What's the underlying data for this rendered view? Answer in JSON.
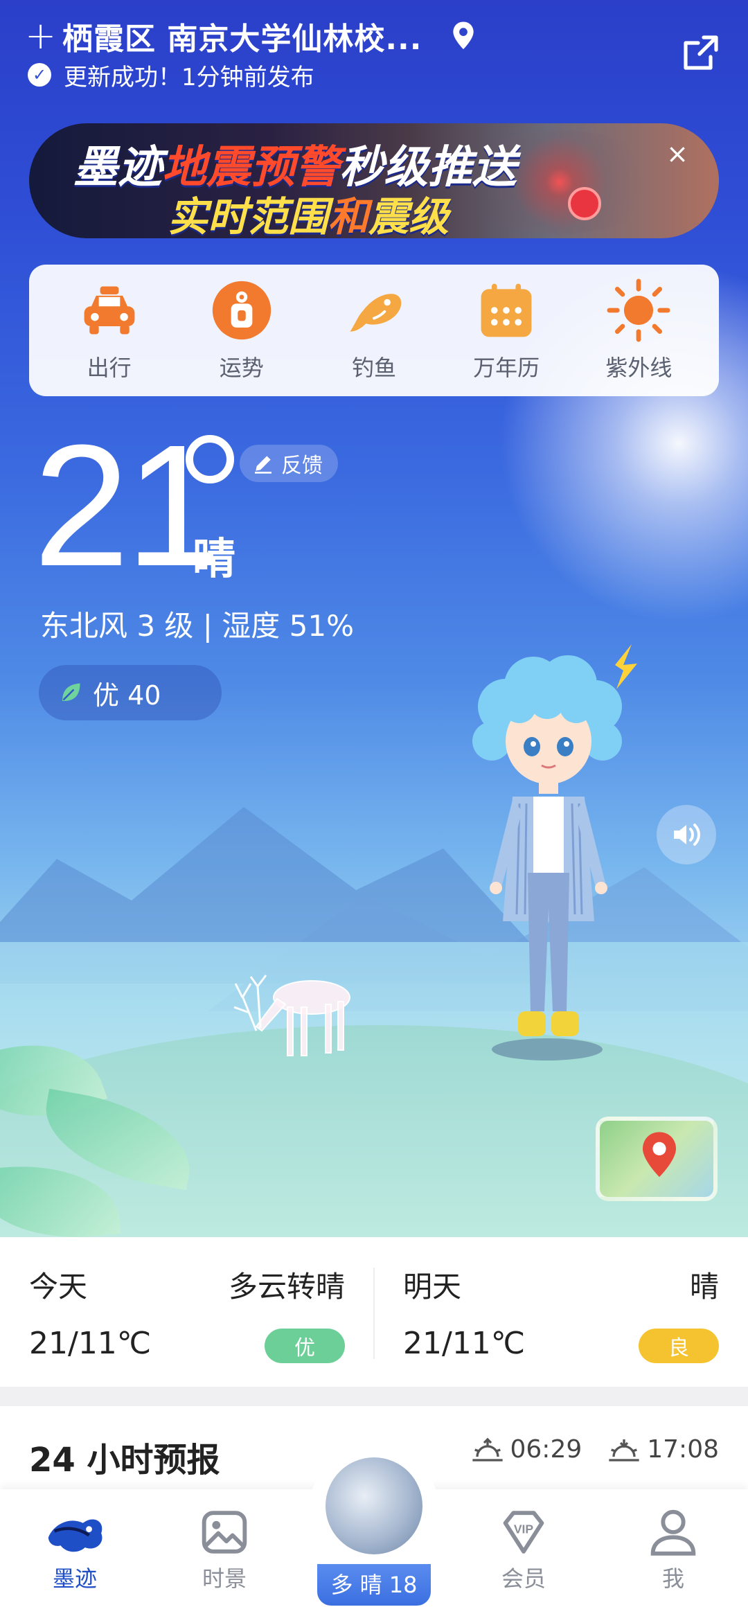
{
  "header": {
    "location": "栖霞区 南京大学仙林校...",
    "update_status": "更新成功！1分钟前发布"
  },
  "banner": {
    "line1_a": "墨迹",
    "line1_b": "地震预警",
    "line1_c": "秒级推送",
    "line2_a": "实时范围",
    "line2_b": "和",
    "line2_c": "震级",
    "close": "×"
  },
  "tools": [
    {
      "label": "出行",
      "icon": "taxi-icon"
    },
    {
      "label": "运势",
      "icon": "fortune-icon"
    },
    {
      "label": "钓鱼",
      "icon": "fish-icon"
    },
    {
      "label": "万年历",
      "icon": "calendar-icon"
    },
    {
      "label": "紫外线",
      "icon": "sun-icon"
    }
  ],
  "current": {
    "temperature": "21",
    "condition": "晴",
    "feedback": "反馈",
    "wind_humidity": "东北风 3 级 | 湿度 51%",
    "aqi": "优 40"
  },
  "forecast": {
    "today": {
      "day": "今天",
      "condition": "多云转晴",
      "range": "21/11℃",
      "aqi": "优",
      "aqi_color": "#6ccf98"
    },
    "tomorrow": {
      "day": "明天",
      "condition": "晴",
      "range": "21/11℃",
      "aqi": "良",
      "aqi_color": "#f5c330"
    }
  },
  "hourly": {
    "title": "24 小时预报",
    "sunrise": "06:29",
    "sunset": "17:08"
  },
  "tabbar": {
    "items": [
      {
        "label": "墨迹",
        "active": true
      },
      {
        "label": "时景",
        "active": false
      },
      {
        "label": "会员",
        "active": false
      },
      {
        "label": "我",
        "active": false
      }
    ],
    "center_label": "多 晴 18"
  },
  "colors": {
    "accent": "#1f4fc6",
    "tool_orange": "#f27a2e"
  }
}
